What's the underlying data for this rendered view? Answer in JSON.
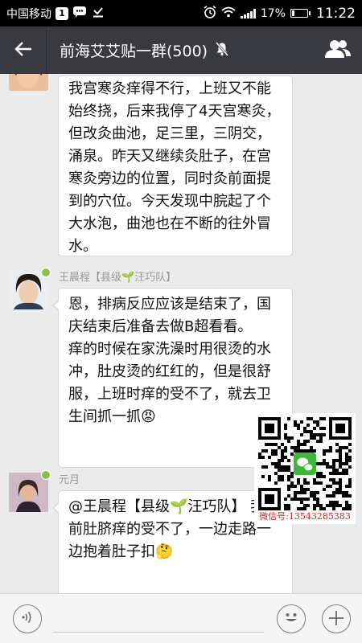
{
  "status_bar": {
    "carrier": "中国移动",
    "notification_count": "1",
    "battery": "17%",
    "time": "11:22"
  },
  "header": {
    "title": "前海艾艾贴一群(500)",
    "back_icon": "back-arrow-icon",
    "mute_icon": "bell-off-icon",
    "group_icon": "group-members-icon"
  },
  "messages": [
    {
      "sender": "",
      "text": "我宫寒灸痒得不行，上班又不能始终挠，后来我停了4天宫寒灸，但改灸曲池，足三里，三阴交，涌泉。昨天又继续灸肚子，在宫寒灸旁边的位置，同时灸前面提到的穴位。今天发现中脘起了个大水泡，曲池也在不断的往外冒水。"
    },
    {
      "sender": "王晨程【县级🌱汪巧队】",
      "text": "恩，排病反应应该是结束了，国庆结束后准备去做B超看看。\n痒的时候在家洗澡时用很烫的水冲，肚皮烫的红红的，但是很舒服，上班时痒的受不了，就去卫生间抓一抓😡"
    },
    {
      "sender": "元月",
      "text": "@王晨程【县级🌱汪巧队】 我之前肚脐痒的受不了，一边走路一边抱着肚子扣🤔"
    }
  ],
  "qr": {
    "caption": "微信号:13543285383"
  },
  "input_bar": {
    "placeholder": "",
    "voice_icon": "voice-icon",
    "emoji_icon": "emoji-icon",
    "plus_icon": "plus-icon"
  },
  "colors": {
    "title_bar": "#393a3f",
    "chat_background": "#ebebeb",
    "badge_green": "#8bc34a",
    "qr_caption_red": "#d32020"
  }
}
